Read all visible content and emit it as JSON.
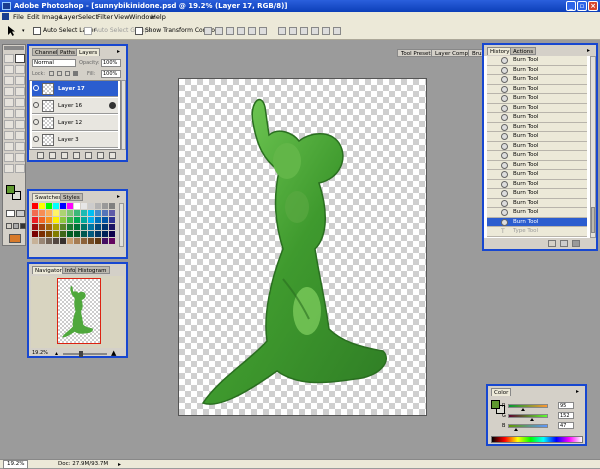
{
  "window": {
    "title": "Adobe Photoshop - [sunnybikinidone.psd @ 19.2% (Layer 17, RGB/8)]"
  },
  "menu": [
    "File",
    "Edit",
    "Image",
    "Layer",
    "Select",
    "Filter",
    "View",
    "Window",
    "Help"
  ],
  "options": {
    "auto_select_layer": "Auto Select Layer",
    "auto_select_groups": "Auto Select Groups",
    "show_transform": "Show Transform Controls"
  },
  "workspace_tabs": [
    "Tool Presets",
    "Layer Comps",
    "Brushes"
  ],
  "layers_panel": {
    "tabs": [
      "Channels",
      "Paths",
      "Layers"
    ],
    "blend_mode": "Normal",
    "opacity_label": "Opacity:",
    "opacity_value": "100%",
    "lock_label": "Lock:",
    "fill_label": "Fill:",
    "fill_value": "100%",
    "layers": [
      "Layer 17",
      "Layer 16",
      "Layer 12",
      "Layer 3"
    ]
  },
  "swatches_panel": {
    "tabs": [
      "Swatches",
      "Styles"
    ]
  },
  "navigator_panel": {
    "tabs": [
      "Navigator",
      "Info",
      "Histogram"
    ],
    "zoom": "19.2%"
  },
  "history_panel": {
    "tabs": [
      "History",
      "Actions"
    ],
    "items": [
      "Burn Tool",
      "Burn Tool",
      "Burn Tool",
      "Burn Tool",
      "Burn Tool",
      "Burn Tool",
      "Burn Tool",
      "Burn Tool",
      "Burn Tool",
      "Burn Tool",
      "Burn Tool",
      "Burn Tool",
      "Burn Tool",
      "Burn Tool",
      "Burn Tool",
      "Burn Tool",
      "Burn Tool",
      "Burn Tool",
      "Type Tool"
    ],
    "selected_index": 17
  },
  "color_panel": {
    "tab": "Color",
    "channels": [
      {
        "label": "R",
        "value": "95"
      },
      {
        "label": "G",
        "value": "152"
      },
      {
        "label": "B",
        "value": "47"
      }
    ],
    "foreground": "#5f982f",
    "background": "#dcdcd4"
  },
  "status": {
    "zoom": "19.2%",
    "doc": "Doc: 27.9M/93.7M"
  },
  "colors": {
    "title_blue": "#0c3fb8",
    "panel_border": "#1747d0",
    "selection": "#2b5dcf",
    "figure_green": "#4fa83c"
  }
}
